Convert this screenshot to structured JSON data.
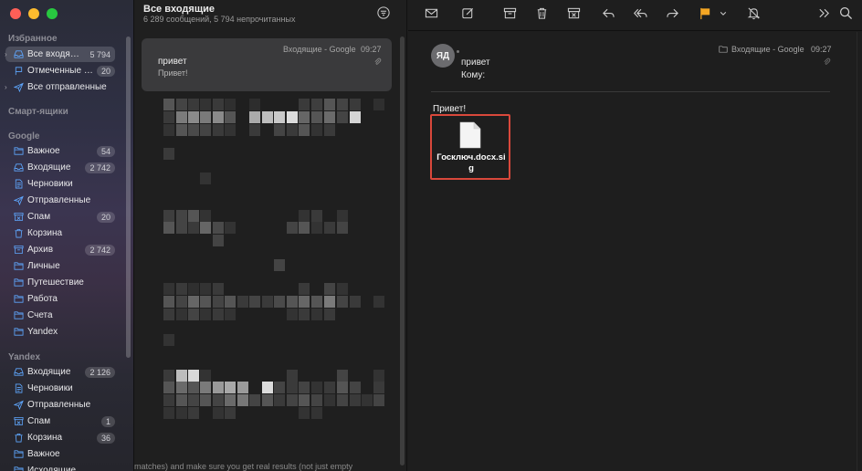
{
  "sidebar": {
    "sections": {
      "favorites": "Избранное",
      "smart": "Смарт-ящики",
      "google": "Google",
      "yandex": "Yandex"
    },
    "favorites": [
      {
        "label": "Все входящ…",
        "badge": "5 794",
        "icon": "tray-icon"
      },
      {
        "label": "Отмеченные ф…",
        "badge": "20",
        "icon": "flag-icon"
      },
      {
        "label": "Все отправленные",
        "badge": "",
        "icon": "paperplane-icon"
      }
    ],
    "google": [
      {
        "label": "Важное",
        "badge": "54",
        "icon": "folder-icon"
      },
      {
        "label": "Входящие",
        "badge": "2 742",
        "icon": "tray-icon"
      },
      {
        "label": "Черновики",
        "badge": "",
        "icon": "document-icon"
      },
      {
        "label": "Отправленные",
        "badge": "",
        "icon": "paperplane-icon"
      },
      {
        "label": "Спам",
        "badge": "20",
        "icon": "junk-icon"
      },
      {
        "label": "Корзина",
        "badge": "",
        "icon": "trash-icon"
      },
      {
        "label": "Архив",
        "badge": "2 742",
        "icon": "archive-icon"
      },
      {
        "label": "Личные",
        "badge": "",
        "icon": "folder-icon"
      },
      {
        "label": "Путешествие",
        "badge": "",
        "icon": "folder-icon"
      },
      {
        "label": "Работа",
        "badge": "",
        "icon": "folder-icon"
      },
      {
        "label": "Счета",
        "badge": "",
        "icon": "folder-icon"
      },
      {
        "label": "Yandex",
        "badge": "",
        "icon": "folder-icon"
      }
    ],
    "yandex": [
      {
        "label": "Входящие",
        "badge": "2 126",
        "icon": "tray-icon"
      },
      {
        "label": "Черновики",
        "badge": "",
        "icon": "document-icon"
      },
      {
        "label": "Отправленные",
        "badge": "",
        "icon": "paperplane-icon"
      },
      {
        "label": "Спам",
        "badge": "1",
        "icon": "junk-icon"
      },
      {
        "label": "Корзина",
        "badge": "36",
        "icon": "trash-icon"
      },
      {
        "label": "Важное",
        "badge": "",
        "icon": "folder-icon"
      },
      {
        "label": "Исходящие",
        "badge": "",
        "icon": "folder-icon"
      }
    ]
  },
  "list": {
    "title": "Все входящие",
    "subtitle": "6 289 сообщений, 5 794 непрочитанных",
    "message": {
      "mailbox": "Входящие - Google",
      "time": "09:27",
      "sender": "привет",
      "preview": "Привет!"
    },
    "bottom_text": "matches) and make sure you get real results (not just empty"
  },
  "viewer": {
    "avatar": "ЯД",
    "from": "привет",
    "to_label": "Кому:",
    "mailbox": "Входящие - Google",
    "time": "09:27",
    "body": "Привет!",
    "attachment": "Госключ.docx.sig"
  },
  "colors": {
    "flag": "#f5a623",
    "highlight": "#d9483b",
    "selected": "#4c4e5c"
  }
}
